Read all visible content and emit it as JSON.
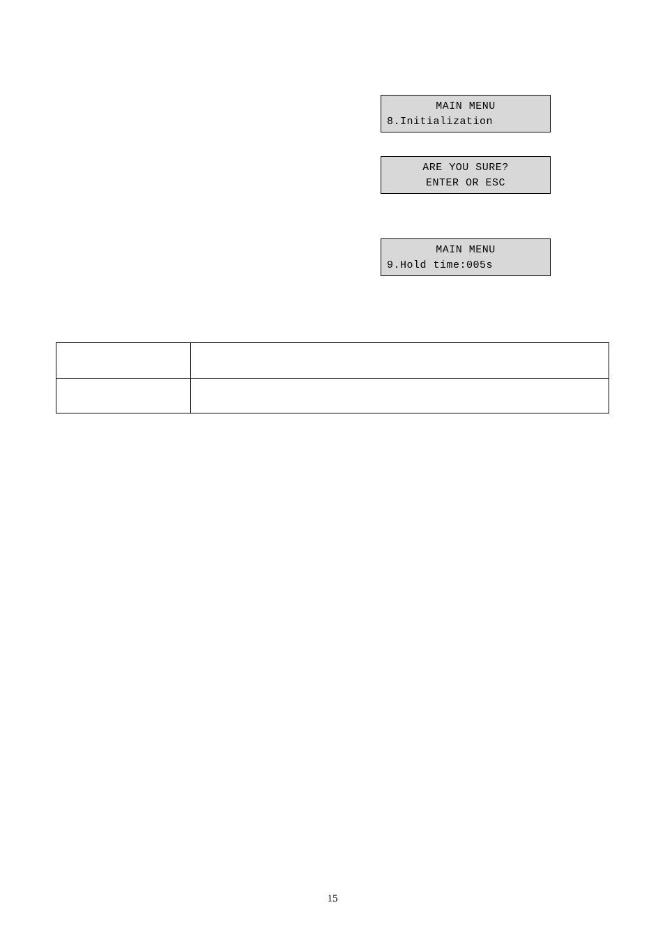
{
  "box1": {
    "line1": "MAIN MENU",
    "line2": "8.Initialization"
  },
  "box2": {
    "line1": "ARE YOU SURE?",
    "line2": "ENTER OR ESC"
  },
  "box3": {
    "line1": "MAIN MENU",
    "line2": "9.Hold time:005s"
  },
  "table": {
    "rows": [
      {
        "left": "",
        "right": ""
      },
      {
        "left": "",
        "right": ""
      }
    ]
  },
  "page_number": "15"
}
